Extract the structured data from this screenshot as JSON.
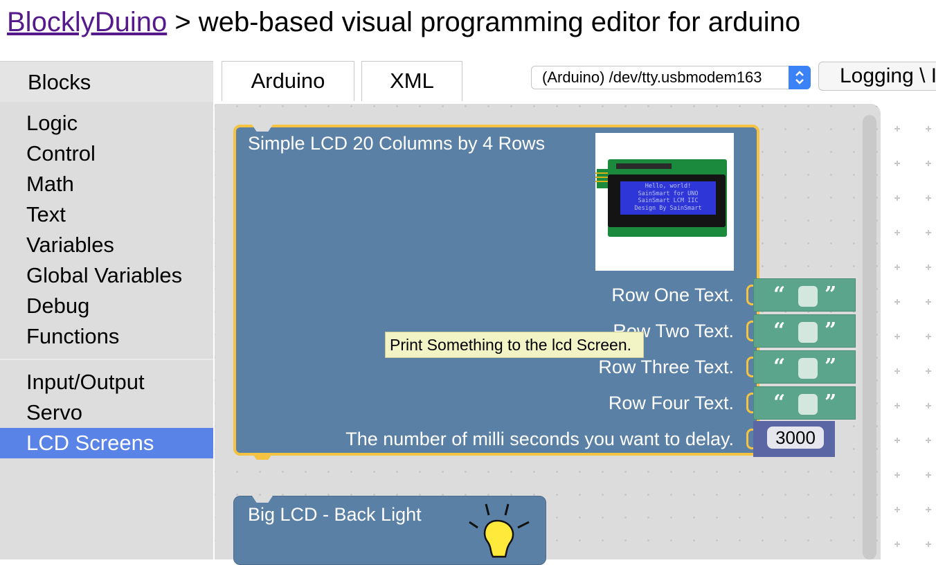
{
  "header": {
    "brand_link": "BlocklyDuino",
    "subtitle": " > web-based visual programming editor for arduino"
  },
  "tabs": {
    "blocks": "Blocks",
    "arduino": "Arduino",
    "xml": "XML"
  },
  "toolbar": {
    "port_select_value": "(Arduino) /dev/tty.usbmodem163",
    "logging_label": "Logging \\ I"
  },
  "sidebar": {
    "items": [
      {
        "label": "Logic"
      },
      {
        "label": "Control"
      },
      {
        "label": "Math"
      },
      {
        "label": "Text"
      },
      {
        "label": "Variables"
      },
      {
        "label": "Global Variables"
      },
      {
        "label": "Debug"
      },
      {
        "label": "Functions"
      },
      {
        "label": "Input/Output"
      },
      {
        "label": "Servo"
      },
      {
        "label": "LCD Screens"
      }
    ],
    "selected": "LCD Screens"
  },
  "workspace": {
    "lcd_block": {
      "title": "Simple LCD 20 Columns by 4 Rows",
      "rows": [
        {
          "label": "Row One Text."
        },
        {
          "label": "Row Two Text."
        },
        {
          "label": "Row Three Text."
        },
        {
          "label": "Row Four Text."
        }
      ],
      "delay_label": "The number of milli seconds you want to delay.",
      "delay_value": "3000",
      "open_quote": "“",
      "close_quote": "”",
      "lcd_image_text": [
        "Hello, world!",
        "SainSmart for UNO",
        "SainSmart LCM IIC",
        "Design By SainSmart"
      ]
    },
    "tooltip": "Print Something to the lcd Screen.",
    "backlight_block": {
      "title": "Big LCD - Back Light"
    }
  },
  "colors": {
    "block_blue": "#5b80a5",
    "text_block_green": "#5ba58c",
    "number_block": "#5b67a5",
    "selection_outline": "#f5c242",
    "sidebar_selected": "#5a83e8",
    "link_purple": "#551a8b"
  }
}
